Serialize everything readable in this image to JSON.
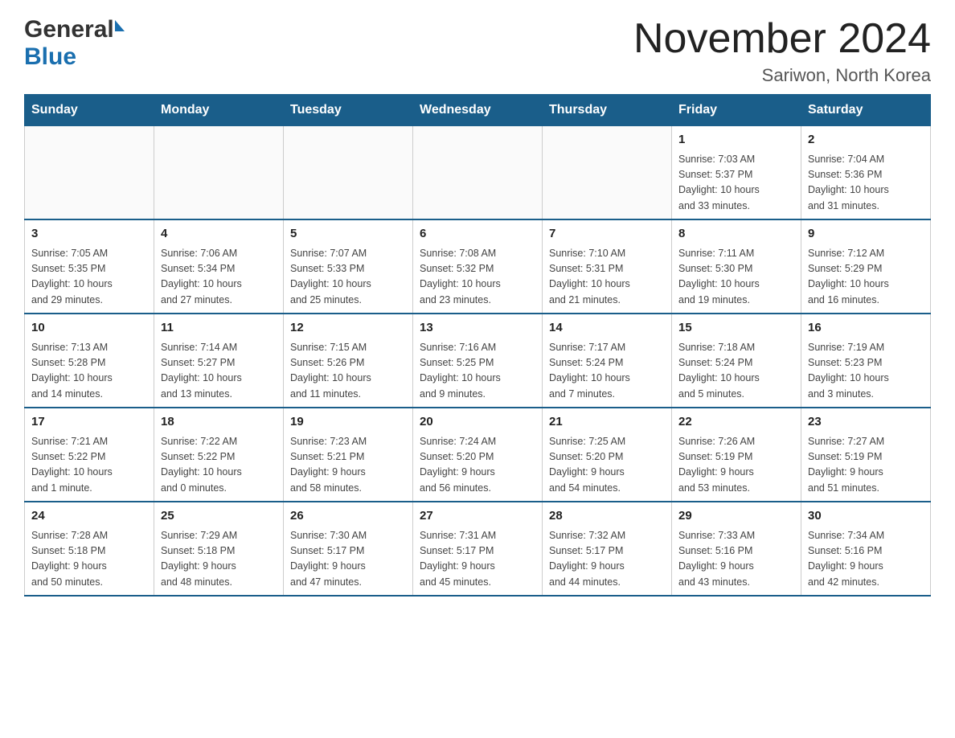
{
  "logo": {
    "general": "General",
    "blue": "Blue"
  },
  "title": "November 2024",
  "subtitle": "Sariwon, North Korea",
  "days_of_week": [
    "Sunday",
    "Monday",
    "Tuesday",
    "Wednesday",
    "Thursday",
    "Friday",
    "Saturday"
  ],
  "weeks": [
    {
      "days": [
        {
          "number": "",
          "info": ""
        },
        {
          "number": "",
          "info": ""
        },
        {
          "number": "",
          "info": ""
        },
        {
          "number": "",
          "info": ""
        },
        {
          "number": "",
          "info": ""
        },
        {
          "number": "1",
          "info": "Sunrise: 7:03 AM\nSunset: 5:37 PM\nDaylight: 10 hours\nand 33 minutes."
        },
        {
          "number": "2",
          "info": "Sunrise: 7:04 AM\nSunset: 5:36 PM\nDaylight: 10 hours\nand 31 minutes."
        }
      ]
    },
    {
      "days": [
        {
          "number": "3",
          "info": "Sunrise: 7:05 AM\nSunset: 5:35 PM\nDaylight: 10 hours\nand 29 minutes."
        },
        {
          "number": "4",
          "info": "Sunrise: 7:06 AM\nSunset: 5:34 PM\nDaylight: 10 hours\nand 27 minutes."
        },
        {
          "number": "5",
          "info": "Sunrise: 7:07 AM\nSunset: 5:33 PM\nDaylight: 10 hours\nand 25 minutes."
        },
        {
          "number": "6",
          "info": "Sunrise: 7:08 AM\nSunset: 5:32 PM\nDaylight: 10 hours\nand 23 minutes."
        },
        {
          "number": "7",
          "info": "Sunrise: 7:10 AM\nSunset: 5:31 PM\nDaylight: 10 hours\nand 21 minutes."
        },
        {
          "number": "8",
          "info": "Sunrise: 7:11 AM\nSunset: 5:30 PM\nDaylight: 10 hours\nand 19 minutes."
        },
        {
          "number": "9",
          "info": "Sunrise: 7:12 AM\nSunset: 5:29 PM\nDaylight: 10 hours\nand 16 minutes."
        }
      ]
    },
    {
      "days": [
        {
          "number": "10",
          "info": "Sunrise: 7:13 AM\nSunset: 5:28 PM\nDaylight: 10 hours\nand 14 minutes."
        },
        {
          "number": "11",
          "info": "Sunrise: 7:14 AM\nSunset: 5:27 PM\nDaylight: 10 hours\nand 13 minutes."
        },
        {
          "number": "12",
          "info": "Sunrise: 7:15 AM\nSunset: 5:26 PM\nDaylight: 10 hours\nand 11 minutes."
        },
        {
          "number": "13",
          "info": "Sunrise: 7:16 AM\nSunset: 5:25 PM\nDaylight: 10 hours\nand 9 minutes."
        },
        {
          "number": "14",
          "info": "Sunrise: 7:17 AM\nSunset: 5:24 PM\nDaylight: 10 hours\nand 7 minutes."
        },
        {
          "number": "15",
          "info": "Sunrise: 7:18 AM\nSunset: 5:24 PM\nDaylight: 10 hours\nand 5 minutes."
        },
        {
          "number": "16",
          "info": "Sunrise: 7:19 AM\nSunset: 5:23 PM\nDaylight: 10 hours\nand 3 minutes."
        }
      ]
    },
    {
      "days": [
        {
          "number": "17",
          "info": "Sunrise: 7:21 AM\nSunset: 5:22 PM\nDaylight: 10 hours\nand 1 minute."
        },
        {
          "number": "18",
          "info": "Sunrise: 7:22 AM\nSunset: 5:22 PM\nDaylight: 10 hours\nand 0 minutes."
        },
        {
          "number": "19",
          "info": "Sunrise: 7:23 AM\nSunset: 5:21 PM\nDaylight: 9 hours\nand 58 minutes."
        },
        {
          "number": "20",
          "info": "Sunrise: 7:24 AM\nSunset: 5:20 PM\nDaylight: 9 hours\nand 56 minutes."
        },
        {
          "number": "21",
          "info": "Sunrise: 7:25 AM\nSunset: 5:20 PM\nDaylight: 9 hours\nand 54 minutes."
        },
        {
          "number": "22",
          "info": "Sunrise: 7:26 AM\nSunset: 5:19 PM\nDaylight: 9 hours\nand 53 minutes."
        },
        {
          "number": "23",
          "info": "Sunrise: 7:27 AM\nSunset: 5:19 PM\nDaylight: 9 hours\nand 51 minutes."
        }
      ]
    },
    {
      "days": [
        {
          "number": "24",
          "info": "Sunrise: 7:28 AM\nSunset: 5:18 PM\nDaylight: 9 hours\nand 50 minutes."
        },
        {
          "number": "25",
          "info": "Sunrise: 7:29 AM\nSunset: 5:18 PM\nDaylight: 9 hours\nand 48 minutes."
        },
        {
          "number": "26",
          "info": "Sunrise: 7:30 AM\nSunset: 5:17 PM\nDaylight: 9 hours\nand 47 minutes."
        },
        {
          "number": "27",
          "info": "Sunrise: 7:31 AM\nSunset: 5:17 PM\nDaylight: 9 hours\nand 45 minutes."
        },
        {
          "number": "28",
          "info": "Sunrise: 7:32 AM\nSunset: 5:17 PM\nDaylight: 9 hours\nand 44 minutes."
        },
        {
          "number": "29",
          "info": "Sunrise: 7:33 AM\nSunset: 5:16 PM\nDaylight: 9 hours\nand 43 minutes."
        },
        {
          "number": "30",
          "info": "Sunrise: 7:34 AM\nSunset: 5:16 PM\nDaylight: 9 hours\nand 42 minutes."
        }
      ]
    }
  ]
}
